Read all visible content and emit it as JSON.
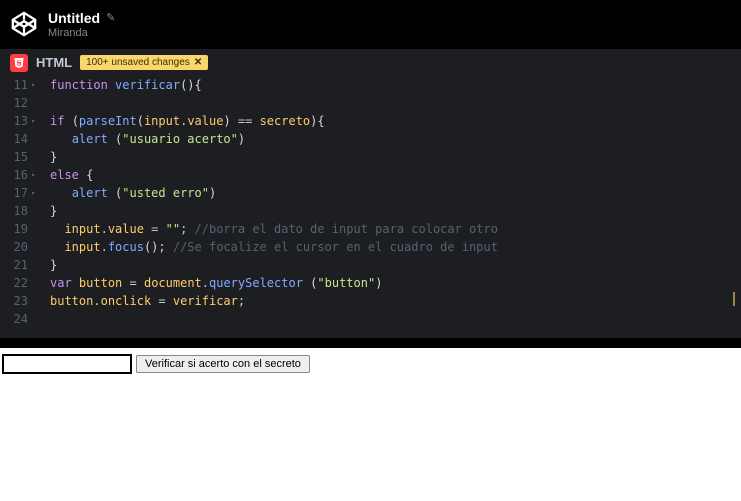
{
  "header": {
    "title": "Untitled",
    "author": "Miranda"
  },
  "panel": {
    "label": "HTML",
    "unsaved_text": "100+ unsaved changes",
    "unsaved_close": "✕"
  },
  "gutter": {
    "start": 11,
    "end": 24,
    "fold_lines": [
      11,
      13,
      16,
      17
    ]
  },
  "code": [
    [
      [
        "kw",
        "function"
      ],
      [
        "op",
        " "
      ],
      [
        "fn",
        "verificar"
      ],
      [
        "paren",
        "(){"
      ]
    ],
    [],
    [
      [
        "kw",
        "if"
      ],
      [
        "op",
        " "
      ],
      [
        "paren",
        "("
      ],
      [
        "fn",
        "parseInt"
      ],
      [
        "paren",
        "("
      ],
      [
        "id",
        "input"
      ],
      [
        "op",
        "."
      ],
      [
        "id",
        "value"
      ],
      [
        "paren",
        ")"
      ],
      [
        "op",
        " == "
      ],
      [
        "id",
        "secreto"
      ],
      [
        "paren",
        "){"
      ]
    ],
    [
      [
        "op",
        "   "
      ],
      [
        "fn",
        "alert"
      ],
      [
        "op",
        " "
      ],
      [
        "paren",
        "("
      ],
      [
        "str",
        "\"usuario acerto\""
      ],
      [
        "paren",
        ")"
      ]
    ],
    [
      [
        "paren",
        "}"
      ]
    ],
    [
      [
        "kw",
        "else"
      ],
      [
        "op",
        " "
      ],
      [
        "paren",
        "{"
      ]
    ],
    [
      [
        "op",
        "   "
      ],
      [
        "fn",
        "alert"
      ],
      [
        "op",
        " "
      ],
      [
        "paren",
        "("
      ],
      [
        "str",
        "\"usted erro\""
      ],
      [
        "paren",
        ")"
      ]
    ],
    [
      [
        "paren",
        "}"
      ]
    ],
    [
      [
        "op",
        "  "
      ],
      [
        "id",
        "input"
      ],
      [
        "op",
        "."
      ],
      [
        "id",
        "value"
      ],
      [
        "op",
        " = "
      ],
      [
        "str",
        "\"\""
      ],
      [
        "op",
        "; "
      ],
      [
        "cm",
        "//borra el dato de input para colocar otro"
      ]
    ],
    [
      [
        "op",
        "  "
      ],
      [
        "id",
        "input"
      ],
      [
        "op",
        "."
      ],
      [
        "fn",
        "focus"
      ],
      [
        "paren",
        "()"
      ],
      [
        "op",
        "; "
      ],
      [
        "cm",
        "//Se focalize el cursor en el cuadro de input"
      ]
    ],
    [
      [
        "paren",
        "}"
      ]
    ],
    [
      [
        "kw",
        "var"
      ],
      [
        "op",
        " "
      ],
      [
        "id",
        "button"
      ],
      [
        "op",
        " = "
      ],
      [
        "id",
        "document"
      ],
      [
        "op",
        "."
      ],
      [
        "fn",
        "querySelector"
      ],
      [
        "op",
        " "
      ],
      [
        "paren",
        "("
      ],
      [
        "str",
        "\"button\""
      ],
      [
        "paren",
        ")"
      ]
    ],
    [
      [
        "id",
        "button"
      ],
      [
        "op",
        "."
      ],
      [
        "id",
        "onclick"
      ],
      [
        "op",
        " = "
      ],
      [
        "id",
        "verificar"
      ],
      [
        "op",
        ";"
      ]
    ],
    []
  ],
  "output": {
    "input_value": "",
    "button_label": "Verificar si acerto con el secreto"
  }
}
